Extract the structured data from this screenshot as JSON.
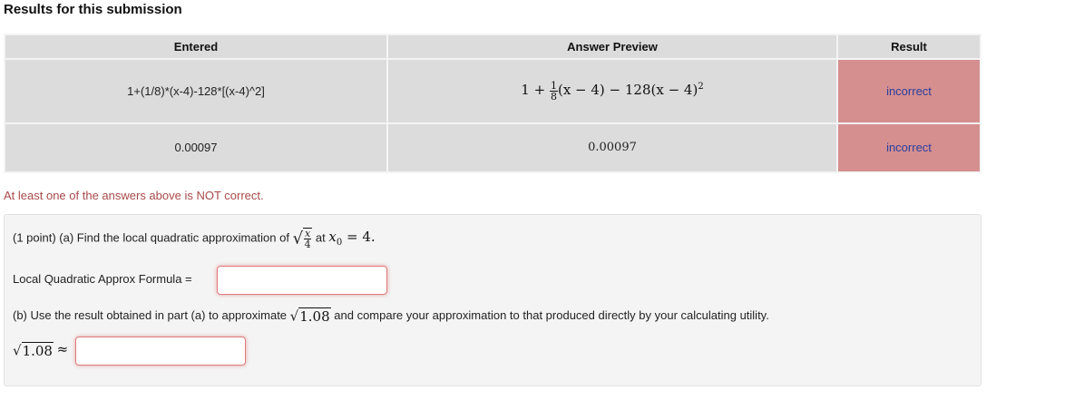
{
  "page": {
    "title": "Results for this submission"
  },
  "table": {
    "headers": {
      "entered": "Entered",
      "preview": "Answer Preview",
      "result": "Result"
    },
    "rows": [
      {
        "entered": "1+(1/8)*(x-4)-128*[(x-4)^2]",
        "preview_prefix": "1 +",
        "preview_frac_num": "1",
        "preview_frac_den": "8",
        "preview_suffix": "(x − 4) − 128(x − 4)",
        "preview_exp": "2",
        "result": "incorrect"
      },
      {
        "entered": "0.00097",
        "preview": "0.00097",
        "result": "incorrect"
      }
    ]
  },
  "warning": "At least one of the answers above is NOT correct.",
  "problem": {
    "part_a_text": "(1 point) (a) Find the local quadratic approximation of",
    "part_a_frac_num": "x",
    "part_a_frac_den": "4",
    "part_a_at": "at",
    "part_a_point": "x",
    "part_a_point_sub": "0",
    "part_a_eq": "= 4.",
    "formula_label": "Local Quadratic Approx Formula =",
    "formula_value": "",
    "part_b_text_1": "(b) Use the result obtained in part (a) to approximate",
    "part_b_radicand": "1.08",
    "part_b_text_2": "and compare your approximation to that produced directly by your calculating utility.",
    "approx_radicand": "1.08",
    "approx_symbol": "≈",
    "approx_value": ""
  },
  "colors": {
    "incorrect_bg": "#d58f8f",
    "incorrect_text": "#2a3f9e",
    "warning": "#a94a4a"
  }
}
